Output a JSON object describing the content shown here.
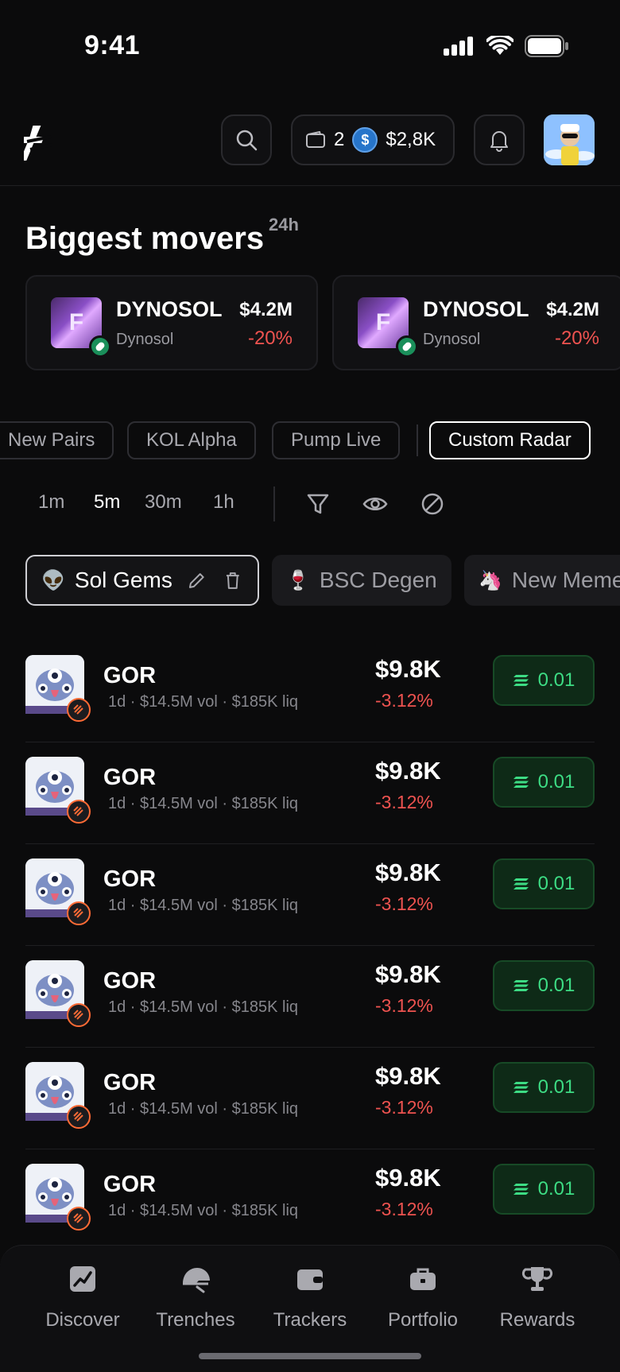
{
  "status": {
    "time": "9:41"
  },
  "header": {
    "wallet_count": "2",
    "balance": "$2,8K",
    "coin_symbol": "$"
  },
  "movers": {
    "title": "Biggest movers",
    "period": "24h",
    "cards": [
      {
        "symbol": "DYNOSOL",
        "name": "Dynosol",
        "mcap": "$4.2M",
        "change": "-20%",
        "letter": "F"
      },
      {
        "symbol": "DYNOSOL",
        "name": "Dynosol",
        "mcap": "$4.2M",
        "change": "-20%",
        "letter": "F"
      }
    ]
  },
  "categories": [
    "New Pairs",
    "KOL Alpha",
    "Pump Live",
    "Custom Radar"
  ],
  "active_category": "Custom Radar",
  "time_filters": [
    "1m",
    "5m",
    "30m",
    "1h"
  ],
  "active_time": "5m",
  "radars": [
    {
      "emoji": "👽",
      "label": "Sol Gems"
    },
    {
      "emoji": "🍷",
      "label": "BSC Degen"
    },
    {
      "emoji": "🦄",
      "label": "New Meme"
    }
  ],
  "tokens": [
    {
      "symbol": "GOR",
      "meta": "1d · $14.5M vol · $185K liq",
      "price": "$9.8K",
      "change": "-3.12%",
      "buy_amount": "0.01"
    },
    {
      "symbol": "GOR",
      "meta": "1d · $14.5M vol · $185K liq",
      "price": "$9.8K",
      "change": "-3.12%",
      "buy_amount": "0.01"
    },
    {
      "symbol": "GOR",
      "meta": "1d · $14.5M vol · $185K liq",
      "price": "$9.8K",
      "change": "-3.12%",
      "buy_amount": "0.01"
    },
    {
      "symbol": "GOR",
      "meta": "1d · $14.5M vol · $185K liq",
      "price": "$9.8K",
      "change": "-3.12%",
      "buy_amount": "0.01"
    },
    {
      "symbol": "GOR",
      "meta": "1d · $14.5M vol · $185K liq",
      "price": "$9.8K",
      "change": "-3.12%",
      "buy_amount": "0.01"
    },
    {
      "symbol": "GOR",
      "meta": "1d · $14.5M vol · $185K liq",
      "price": "$9.8K",
      "change": "-3.12%",
      "buy_amount": "0.01"
    }
  ],
  "nav": [
    "Discover",
    "Trenches",
    "Trackers",
    "Portfolio",
    "Rewards"
  ],
  "colors": {
    "background": "#0b0b0c",
    "negative": "#ef5350",
    "positive": "#3ddc84",
    "usdc": "#2775ca"
  }
}
